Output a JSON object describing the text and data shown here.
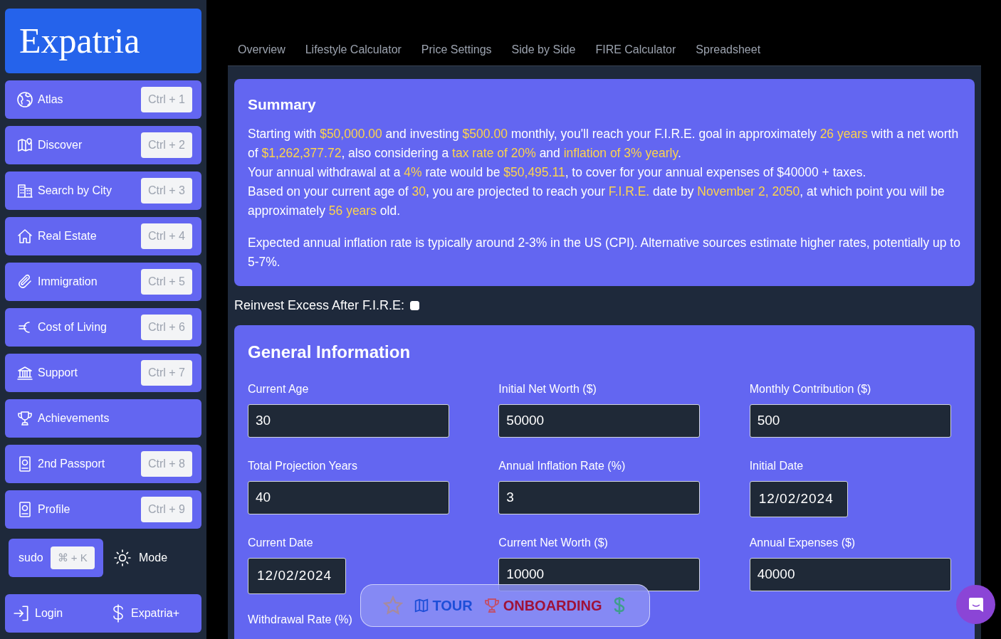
{
  "logo": "Expatria",
  "sidebar": {
    "items": [
      {
        "label": "Atlas",
        "kind": "globe",
        "shortcut": "Ctrl + 1"
      },
      {
        "label": "Discover",
        "kind": "map",
        "shortcut": "Ctrl + 2"
      },
      {
        "label": "Search by City",
        "kind": "building",
        "shortcut": "Ctrl + 3"
      },
      {
        "label": "Real Estate",
        "kind": "house",
        "shortcut": "Ctrl + 4"
      },
      {
        "label": "Immigration",
        "kind": "clip",
        "shortcut": "Ctrl + 5"
      },
      {
        "label": "Cost of Living",
        "kind": "euro",
        "shortcut": "Ctrl + 6"
      },
      {
        "label": "Support",
        "kind": "bank",
        "shortcut": "Ctrl + 7"
      },
      {
        "label": "Achievements",
        "kind": "trophy"
      },
      {
        "label": "2nd Passport",
        "kind": "passport",
        "shortcut": "Ctrl + 8"
      },
      {
        "label": "Profile",
        "kind": "passport",
        "shortcut": "Ctrl + 9"
      }
    ],
    "sudo": {
      "label": "sudo",
      "shortcut": "⌘ + K"
    },
    "mode": "Mode",
    "login": "Login",
    "plus": "Expatria+"
  },
  "tabs": [
    "Overview",
    "Lifestyle Calculator",
    "Price Settings",
    "Side by Side",
    "FIRE Calculator",
    "Spreadsheet"
  ],
  "summary": {
    "title": "Summary",
    "lines": [
      [
        {
          "text": "Starting with ",
          "kind": "plain"
        },
        {
          "text": "$50,000.00",
          "kind": "highlight"
        },
        {
          "text": " and investing ",
          "kind": "plain"
        },
        {
          "text": "$500.00",
          "kind": "highlight"
        },
        {
          "text": " monthly, you'll reach your F.I.R.E. goal in approximately ",
          "kind": "plain"
        },
        {
          "text": "26 years",
          "kind": "highlight"
        },
        {
          "text": " with a net worth of ",
          "kind": "plain"
        },
        {
          "text": "$1,262,377.72",
          "kind": "highlight"
        },
        {
          "text": ", also considering a ",
          "kind": "plain"
        },
        {
          "text": "tax rate of 20%",
          "kind": "highlight"
        },
        {
          "text": " and ",
          "kind": "plain"
        },
        {
          "text": "inflation of 3% yearly",
          "kind": "highlight"
        },
        {
          "text": ".",
          "kind": "plain"
        }
      ],
      [
        {
          "text": "Your annual withdrawal at a ",
          "kind": "plain"
        },
        {
          "text": "4%",
          "kind": "highlight"
        },
        {
          "text": " rate would be ",
          "kind": "plain"
        },
        {
          "text": "$50,495.11",
          "kind": "highlight"
        },
        {
          "text": ", to cover for your annual expenses of $40000 + taxes.",
          "kind": "plain"
        }
      ],
      [
        {
          "text": "Based on your current age of ",
          "kind": "plain"
        },
        {
          "text": "30",
          "kind": "highlight"
        },
        {
          "text": ", you are projected to reach your ",
          "kind": "plain"
        },
        {
          "text": "F.I.R.E.",
          "kind": "highlight"
        },
        {
          "text": " date by ",
          "kind": "plain"
        },
        {
          "text": "November 2, 2050",
          "kind": "highlight"
        },
        {
          "text": ", at which point you will be approximately ",
          "kind": "plain"
        },
        {
          "text": "56 years",
          "kind": "highlight"
        },
        {
          "text": " old.",
          "kind": "plain"
        }
      ]
    ],
    "note": "Expected annual inflation rate is typically around 2-3% in the US (CPI). Alternative sources estimate higher rates, potentially up to 5-7%."
  },
  "reinvest": {
    "label": "Reinvest Excess After F.I.R.E:",
    "checked": false
  },
  "general": {
    "title": "General Information",
    "fields": [
      {
        "label": "Current Age",
        "value": "30",
        "kind": "number"
      },
      {
        "label": "Initial Net Worth ($)",
        "value": "50000",
        "kind": "number"
      },
      {
        "label": "Monthly Contribution ($)",
        "value": "500",
        "kind": "number"
      },
      {
        "label": "Total Projection Years",
        "value": "40",
        "kind": "number"
      },
      {
        "label": "Annual Inflation Rate (%)",
        "value": "3",
        "kind": "number"
      },
      {
        "label": "Initial Date",
        "value": "12/02/2024",
        "kind": "date"
      },
      {
        "label": "Current Date",
        "value": "12/02/2024",
        "kind": "date"
      },
      {
        "label": "Current Net Worth ($)",
        "value": "10000",
        "kind": "number"
      },
      {
        "label": "Annual Expenses ($)",
        "value": "40000",
        "kind": "number"
      },
      {
        "label": "Withdrawal Rate (%)"
      }
    ]
  },
  "toolbar": {
    "tour": "TOUR",
    "onboarding": "ONBOARDING"
  }
}
